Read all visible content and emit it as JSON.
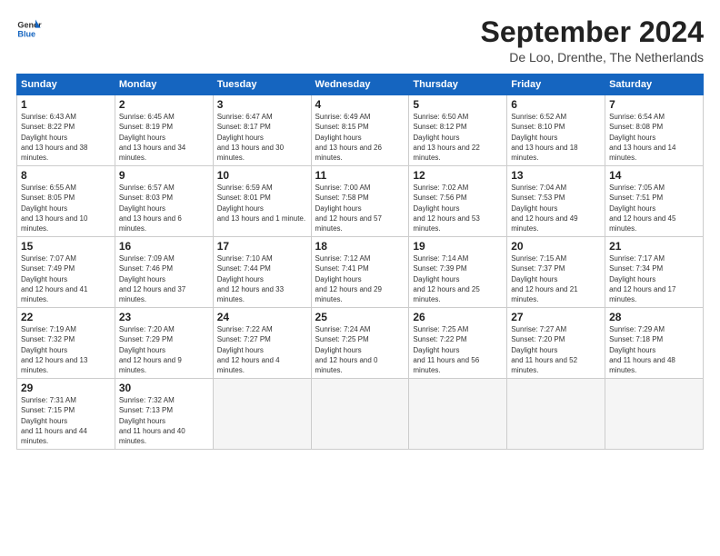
{
  "header": {
    "logo_line1": "General",
    "logo_line2": "Blue",
    "month": "September 2024",
    "location": "De Loo, Drenthe, The Netherlands"
  },
  "weekdays": [
    "Sunday",
    "Monday",
    "Tuesday",
    "Wednesday",
    "Thursday",
    "Friday",
    "Saturday"
  ],
  "weeks": [
    [
      {
        "day": "1",
        "sunrise": "6:43 AM",
        "sunset": "8:22 PM",
        "daylight": "13 hours and 38 minutes."
      },
      {
        "day": "2",
        "sunrise": "6:45 AM",
        "sunset": "8:19 PM",
        "daylight": "13 hours and 34 minutes."
      },
      {
        "day": "3",
        "sunrise": "6:47 AM",
        "sunset": "8:17 PM",
        "daylight": "13 hours and 30 minutes."
      },
      {
        "day": "4",
        "sunrise": "6:49 AM",
        "sunset": "8:15 PM",
        "daylight": "13 hours and 26 minutes."
      },
      {
        "day": "5",
        "sunrise": "6:50 AM",
        "sunset": "8:12 PM",
        "daylight": "13 hours and 22 minutes."
      },
      {
        "day": "6",
        "sunrise": "6:52 AM",
        "sunset": "8:10 PM",
        "daylight": "13 hours and 18 minutes."
      },
      {
        "day": "7",
        "sunrise": "6:54 AM",
        "sunset": "8:08 PM",
        "daylight": "13 hours and 14 minutes."
      }
    ],
    [
      {
        "day": "8",
        "sunrise": "6:55 AM",
        "sunset": "8:05 PM",
        "daylight": "13 hours and 10 minutes."
      },
      {
        "day": "9",
        "sunrise": "6:57 AM",
        "sunset": "8:03 PM",
        "daylight": "13 hours and 6 minutes."
      },
      {
        "day": "10",
        "sunrise": "6:59 AM",
        "sunset": "8:01 PM",
        "daylight": "13 hours and 1 minute."
      },
      {
        "day": "11",
        "sunrise": "7:00 AM",
        "sunset": "7:58 PM",
        "daylight": "12 hours and 57 minutes."
      },
      {
        "day": "12",
        "sunrise": "7:02 AM",
        "sunset": "7:56 PM",
        "daylight": "12 hours and 53 minutes."
      },
      {
        "day": "13",
        "sunrise": "7:04 AM",
        "sunset": "7:53 PM",
        "daylight": "12 hours and 49 minutes."
      },
      {
        "day": "14",
        "sunrise": "7:05 AM",
        "sunset": "7:51 PM",
        "daylight": "12 hours and 45 minutes."
      }
    ],
    [
      {
        "day": "15",
        "sunrise": "7:07 AM",
        "sunset": "7:49 PM",
        "daylight": "12 hours and 41 minutes."
      },
      {
        "day": "16",
        "sunrise": "7:09 AM",
        "sunset": "7:46 PM",
        "daylight": "12 hours and 37 minutes."
      },
      {
        "day": "17",
        "sunrise": "7:10 AM",
        "sunset": "7:44 PM",
        "daylight": "12 hours and 33 minutes."
      },
      {
        "day": "18",
        "sunrise": "7:12 AM",
        "sunset": "7:41 PM",
        "daylight": "12 hours and 29 minutes."
      },
      {
        "day": "19",
        "sunrise": "7:14 AM",
        "sunset": "7:39 PM",
        "daylight": "12 hours and 25 minutes."
      },
      {
        "day": "20",
        "sunrise": "7:15 AM",
        "sunset": "7:37 PM",
        "daylight": "12 hours and 21 minutes."
      },
      {
        "day": "21",
        "sunrise": "7:17 AM",
        "sunset": "7:34 PM",
        "daylight": "12 hours and 17 minutes."
      }
    ],
    [
      {
        "day": "22",
        "sunrise": "7:19 AM",
        "sunset": "7:32 PM",
        "daylight": "12 hours and 13 minutes."
      },
      {
        "day": "23",
        "sunrise": "7:20 AM",
        "sunset": "7:29 PM",
        "daylight": "12 hours and 9 minutes."
      },
      {
        "day": "24",
        "sunrise": "7:22 AM",
        "sunset": "7:27 PM",
        "daylight": "12 hours and 4 minutes."
      },
      {
        "day": "25",
        "sunrise": "7:24 AM",
        "sunset": "7:25 PM",
        "daylight": "12 hours and 0 minutes."
      },
      {
        "day": "26",
        "sunrise": "7:25 AM",
        "sunset": "7:22 PM",
        "daylight": "11 hours and 56 minutes."
      },
      {
        "day": "27",
        "sunrise": "7:27 AM",
        "sunset": "7:20 PM",
        "daylight": "11 hours and 52 minutes."
      },
      {
        "day": "28",
        "sunrise": "7:29 AM",
        "sunset": "7:18 PM",
        "daylight": "11 hours and 48 minutes."
      }
    ],
    [
      {
        "day": "29",
        "sunrise": "7:31 AM",
        "sunset": "7:15 PM",
        "daylight": "11 hours and 44 minutes."
      },
      {
        "day": "30",
        "sunrise": "7:32 AM",
        "sunset": "7:13 PM",
        "daylight": "11 hours and 40 minutes."
      },
      null,
      null,
      null,
      null,
      null
    ]
  ]
}
